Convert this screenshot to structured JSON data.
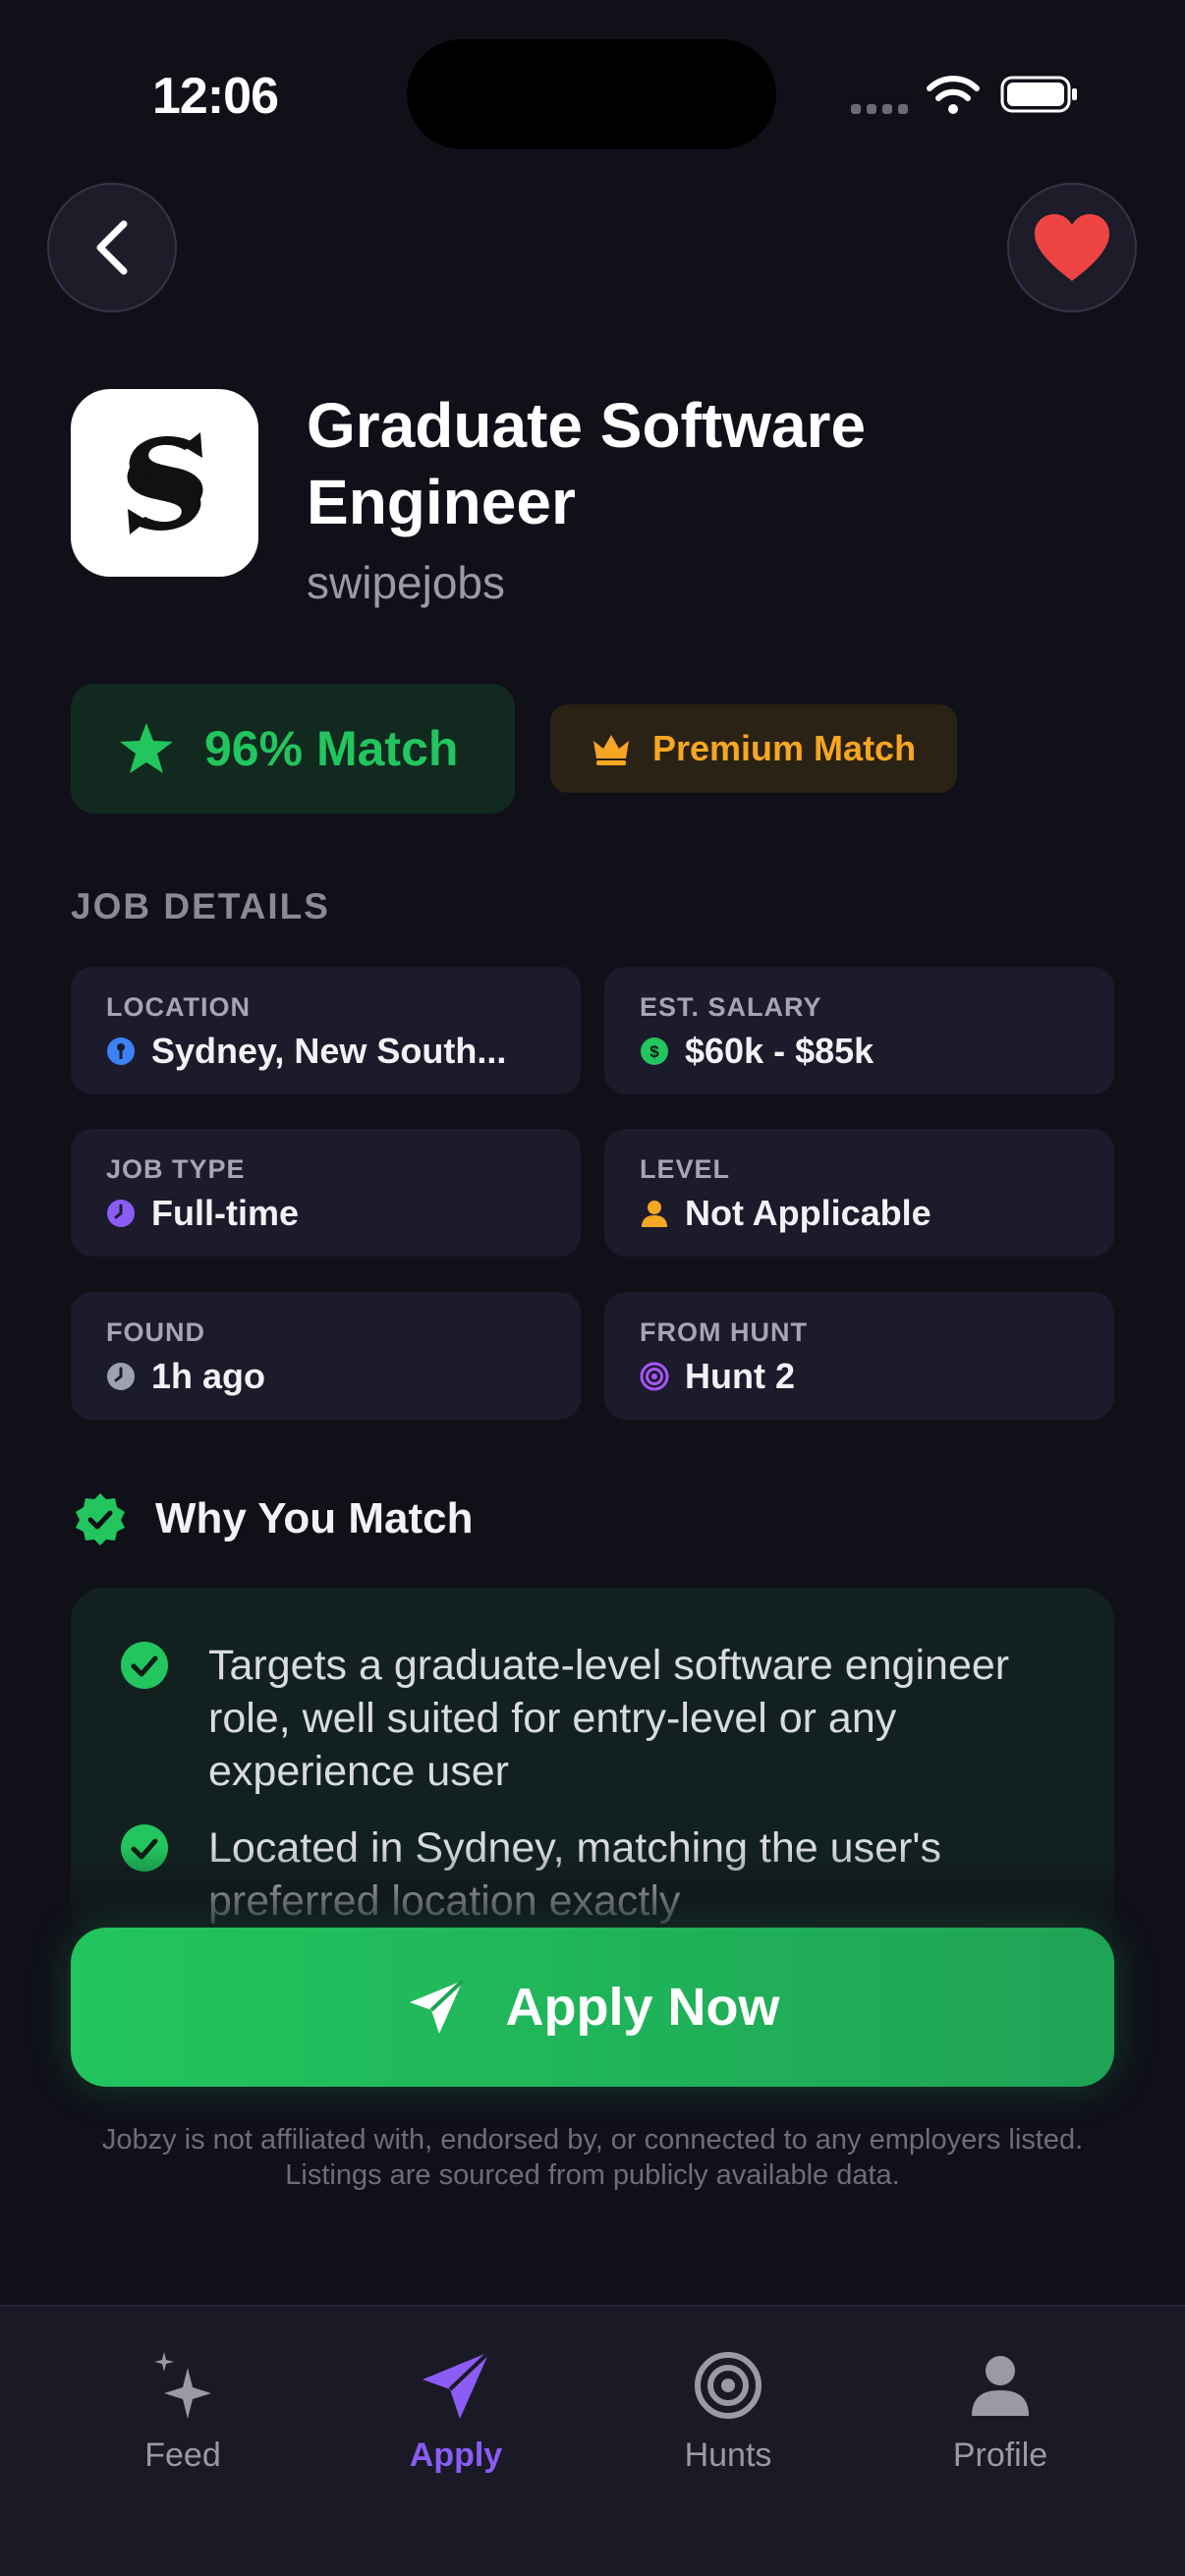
{
  "status_bar": {
    "time": "12:06"
  },
  "job": {
    "title": "Graduate Software Engineer",
    "company": "swipejobs"
  },
  "badges": {
    "match": "96% Match",
    "premium": "Premium Match"
  },
  "details": {
    "section_label": "JOB DETAILS",
    "items": [
      {
        "label": "LOCATION",
        "value": "Sydney, New South...",
        "icon": "location-pin-icon"
      },
      {
        "label": "EST. SALARY",
        "value": "$60k - $85k",
        "icon": "dollar-icon"
      },
      {
        "label": "JOB TYPE",
        "value": "Full-time",
        "icon": "clock-icon"
      },
      {
        "label": "LEVEL",
        "value": "Not Applicable",
        "icon": "person-icon"
      },
      {
        "label": "FOUND",
        "value": "1h ago",
        "icon": "clock-icon"
      },
      {
        "label": "FROM HUNT",
        "value": "Hunt 2",
        "icon": "target-icon"
      }
    ]
  },
  "why_match": {
    "title": "Why You Match",
    "reasons": [
      "Targets a graduate-level software engineer role, well suited for entry-level or any experience user",
      "Located in Sydney, matching the user's preferred location exactly"
    ]
  },
  "apply": {
    "label": "Apply Now"
  },
  "disclaimer": "Jobzy is not affiliated with, endorsed by, or connected to any employers listed. Listings are sourced from publicly available data.",
  "nav": {
    "items": [
      {
        "label": "Feed",
        "icon": "sparkles-icon",
        "active": false
      },
      {
        "label": "Apply",
        "icon": "paper-plane-icon",
        "active": true
      },
      {
        "label": "Hunts",
        "icon": "target-icon",
        "active": false
      },
      {
        "label": "Profile",
        "icon": "person-icon",
        "active": false
      }
    ]
  },
  "colors": {
    "background": "#101019",
    "accent_green": "#22c55e",
    "accent_purple": "#8b5cf6",
    "premium_gold": "#f5a623",
    "favorite_red": "#ef4444"
  }
}
